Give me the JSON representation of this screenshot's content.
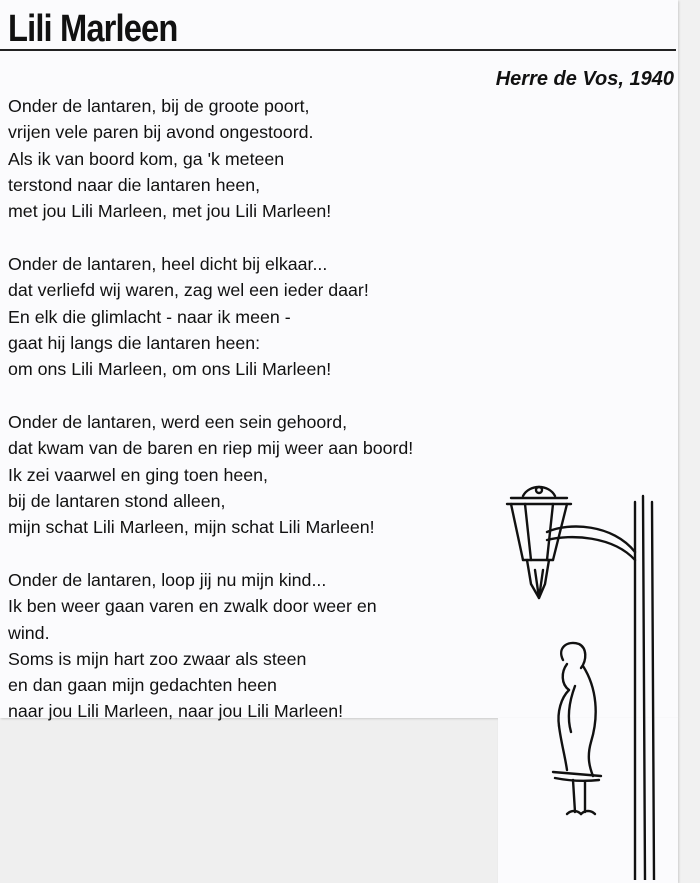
{
  "document": {
    "title": "Lili Marleen",
    "byline": "Herre de Vos, 1940",
    "stanzas": [
      {
        "lines": [
          "Onder de lantaren, bij de groote poort,",
          "vrijen vele paren bij avond ongestoord.",
          "Als ik van boord kom, ga 'k meteen",
          "terstond naar die lantaren heen,",
          "met jou Lili Marleen, met jou Lili Marleen!"
        ]
      },
      {
        "lines": [
          "Onder de lantaren, heel dicht bij elkaar...",
          "dat verliefd wij waren, zag wel een ieder daar!",
          "En elk die glimlacht - naar ik meen -",
          "gaat hij langs die lantaren heen:",
          "om ons Lili Marleen, om ons Lili Marleen!"
        ]
      },
      {
        "lines": [
          "Onder de lantaren, werd een sein gehoord,",
          "dat kwam van de baren en riep mij weer aan boord!",
          "Ik zei vaarwel en ging toen heen,",
          "bij de lantaren stond alleen,",
          "mijn schat Lili Marleen, mijn schat Lili Marleen!"
        ]
      },
      {
        "lines": [
          "Onder de lantaren, loop jij nu mijn kind...",
          "Ik ben weer gaan varen en zwalk door weer en",
          "wind.",
          "Soms is mijn hart zoo zwaar als steen",
          "en dan gaan mijn gedachten heen",
          "naar jou Lili Marleen, naar jou Lili Marleen!"
        ]
      }
    ],
    "illustration_icon": "street-lantern-with-woman-icon"
  }
}
